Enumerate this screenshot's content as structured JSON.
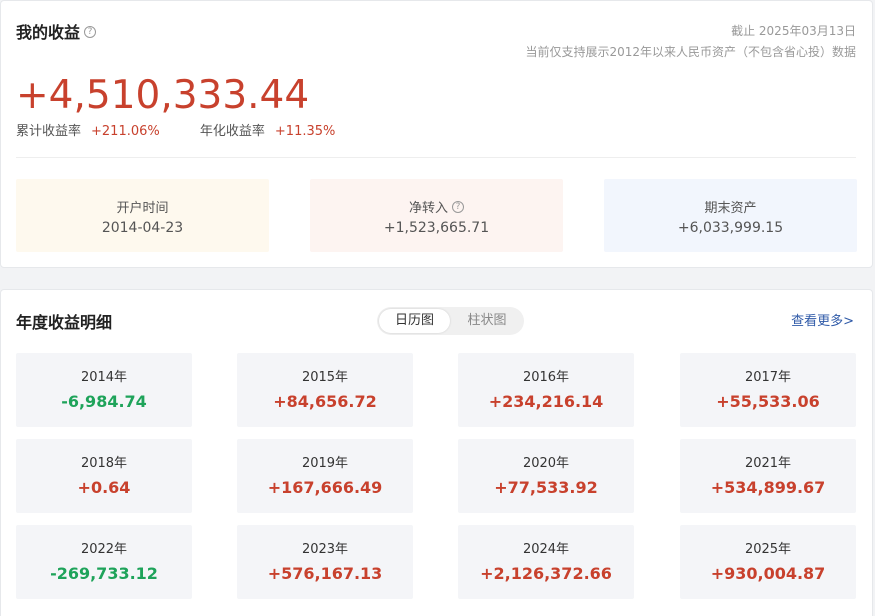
{
  "summary": {
    "title": "我的收益",
    "help": "?",
    "as_of": "截止 2025年03月13日",
    "note": "当前仅支持展示2012年以来人民币资产（不包含省心投）数据",
    "total_profit": "+4,510,333.44",
    "cum_rate_label": "累计收益率",
    "cum_rate_value": "+211.06%",
    "ann_rate_label": "年化收益率",
    "ann_rate_value": "+11.35%",
    "stats": [
      {
        "label": "开户时间",
        "value": "2014-04-23"
      },
      {
        "label": "净转入",
        "value": "+1,523,665.71"
      },
      {
        "label": "期末资产",
        "value": "+6,033,999.15"
      }
    ]
  },
  "yearly": {
    "title": "年度收益明细",
    "tabs": [
      "日历图",
      "柱状图"
    ],
    "more": "查看更多>",
    "items": [
      {
        "year": "2014年",
        "amount": "-6,984.74",
        "sign": "neg"
      },
      {
        "year": "2015年",
        "amount": "+84,656.72",
        "sign": "pos"
      },
      {
        "year": "2016年",
        "amount": "+234,216.14",
        "sign": "pos"
      },
      {
        "year": "2017年",
        "amount": "+55,533.06",
        "sign": "pos"
      },
      {
        "year": "2018年",
        "amount": "+0.64",
        "sign": "pos"
      },
      {
        "year": "2019年",
        "amount": "+167,666.49",
        "sign": "pos"
      },
      {
        "year": "2020年",
        "amount": "+77,533.92",
        "sign": "pos"
      },
      {
        "year": "2021年",
        "amount": "+534,899.67",
        "sign": "pos"
      },
      {
        "year": "2022年",
        "amount": "-269,733.12",
        "sign": "neg"
      },
      {
        "year": "2023年",
        "amount": "+576,167.13",
        "sign": "pos"
      },
      {
        "year": "2024年",
        "amount": "+2,126,372.66",
        "sign": "pos"
      },
      {
        "year": "2025年",
        "amount": "+930,004.87",
        "sign": "pos"
      }
    ]
  },
  "colors": {
    "positive": "#c8412d",
    "negative": "#1ea35a",
    "link": "#2f5aa8"
  }
}
